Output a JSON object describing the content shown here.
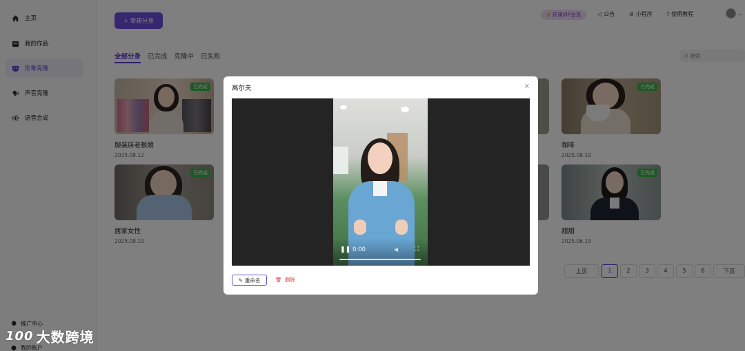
{
  "sidebar": {
    "items": [
      {
        "label": "主页",
        "icon": "home-icon"
      },
      {
        "label": "我的作品",
        "icon": "folder-icon"
      },
      {
        "label": "形象克隆",
        "icon": "mask-icon"
      },
      {
        "label": "声音克隆",
        "icon": "voice-icon"
      },
      {
        "label": "语音合成",
        "icon": "waveform-icon"
      }
    ],
    "bottom": [
      {
        "label": "推广中心",
        "icon": "share-icon"
      },
      {
        "label": "我的账户",
        "icon": "user-icon"
      }
    ],
    "watermark": "大数跨境",
    "watermark_logo": "100"
  },
  "toolbar": {
    "new_button": "+ 新建分身",
    "vip": "开通VIP会员",
    "announcement": "公告",
    "mini_program": "小程序",
    "tutorial": "使用教程"
  },
  "tabs": [
    "全部分身",
    "已完成",
    "克隆中",
    "已失败"
  ],
  "search": {
    "placeholder": "搜索"
  },
  "cards": [
    {
      "title": "服装店老板娘",
      "date": "2025.08.12",
      "status": "已完成"
    },
    {
      "title": "咖啡",
      "date": "2025.08.10",
      "status": "已完成"
    },
    {
      "title": "居家女性",
      "date": "2025.08.10",
      "status": "已完成"
    },
    {
      "title": "甜甜",
      "date": "2025.06.19",
      "status": "已完成"
    }
  ],
  "pagination": {
    "prev": "上页",
    "next": "下页",
    "pages": [
      "1",
      "2",
      "3",
      "4",
      "5",
      "6"
    ],
    "current": "1"
  },
  "modal": {
    "title": "高尔夫",
    "close": "×",
    "time": "0:00",
    "rename": "重命名",
    "delete": "删除"
  },
  "colors": {
    "accent": "#6a4ee0",
    "badge": "#3bb34a",
    "danger": "#e0464a"
  }
}
